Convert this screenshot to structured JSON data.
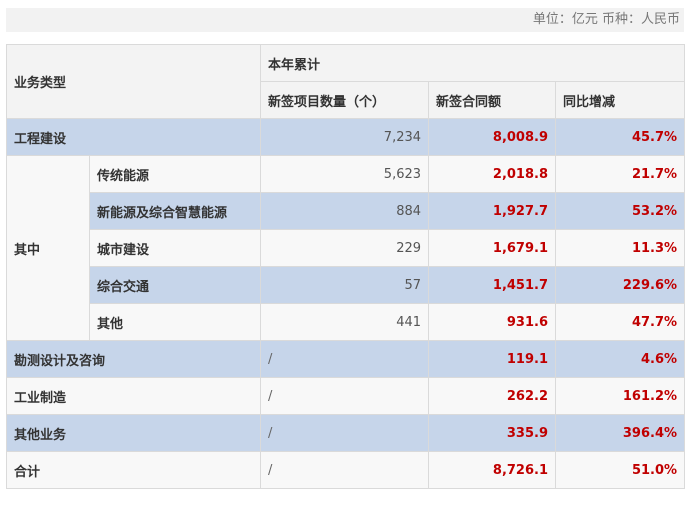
{
  "unit_note": "单位：亿元 币种：人民币",
  "header": {
    "business_type": "业务类型",
    "ytd": "本年累计",
    "col_projects": "新签项目数量（个）",
    "col_amount": "新签合同额",
    "col_yoy": "同比增减"
  },
  "rows": {
    "engineering": {
      "label": "工程建设",
      "projects": "7,234",
      "amount": "8,008.9",
      "yoy": "45.7%"
    },
    "group_label": "其中",
    "sub": [
      {
        "label": "传统能源",
        "projects": "5,623",
        "amount": "2,018.8",
        "yoy": "21.7%"
      },
      {
        "label": "新能源及综合智慧能源",
        "projects": "884",
        "amount": "1,927.7",
        "yoy": "53.2%"
      },
      {
        "label": "城市建设",
        "projects": "229",
        "amount": "1,679.1",
        "yoy": "11.3%"
      },
      {
        "label": "综合交通",
        "projects": "57",
        "amount": "1,451.7",
        "yoy": "229.6%"
      },
      {
        "label": "其他",
        "projects": "441",
        "amount": "931.6",
        "yoy": "47.7%"
      }
    ],
    "survey": {
      "label": "勘测设计及咨询",
      "projects": "/",
      "amount": "119.1",
      "yoy": "4.6%"
    },
    "manufacturing": {
      "label": "工业制造",
      "projects": "/",
      "amount": "262.2",
      "yoy": "161.2%"
    },
    "other_business": {
      "label": "其他业务",
      "projects": "/",
      "amount": "335.9",
      "yoy": "396.4%"
    },
    "total": {
      "label": "合计",
      "projects": "/",
      "amount": "8,726.1",
      "yoy": "51.0%"
    }
  }
}
